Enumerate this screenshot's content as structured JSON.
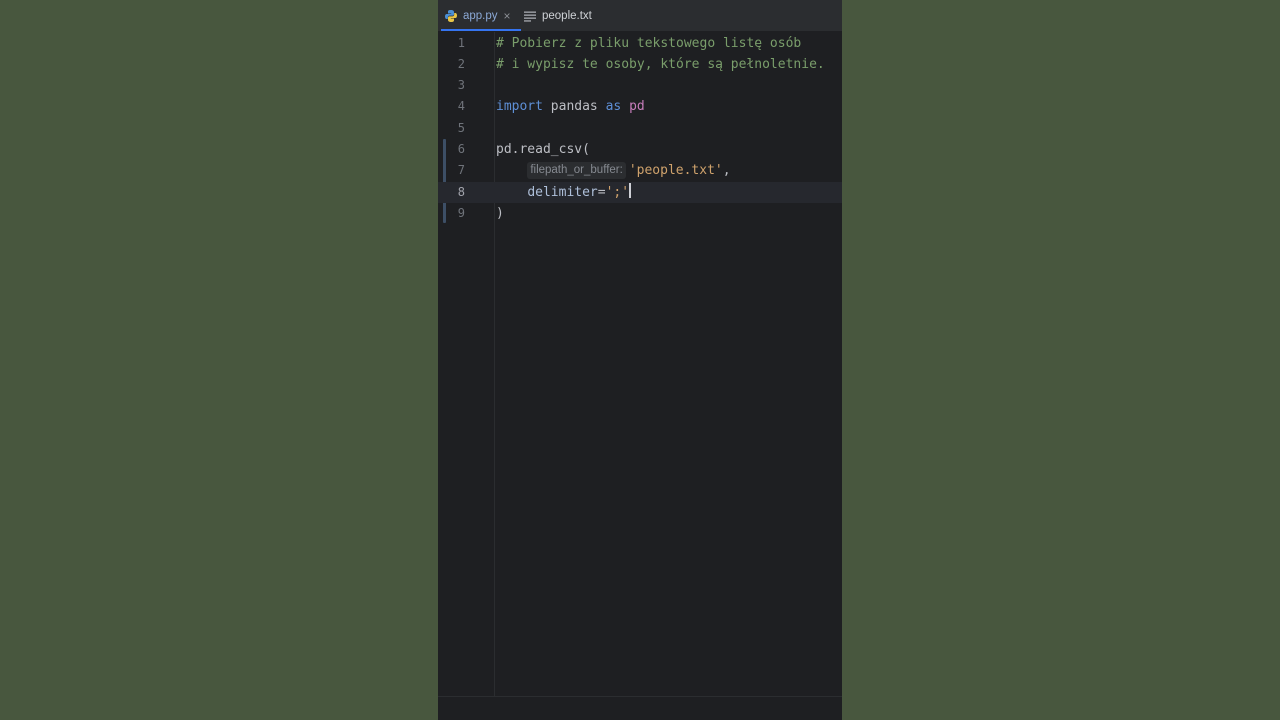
{
  "tabs": [
    {
      "label": "app.py",
      "icon": "python-icon",
      "active": true,
      "close": "×"
    },
    {
      "label": "people.txt",
      "icon": "text-file-icon",
      "active": false
    }
  ],
  "editor": {
    "current_line": 8,
    "lines": [
      {
        "n": "1",
        "tokens": [
          {
            "t": "# Pobierz z pliku tekstowego listę osób",
            "c": "comment"
          }
        ]
      },
      {
        "n": "2",
        "tokens": [
          {
            "t": "# i wypisz te osoby, które są pełnoletnie.",
            "c": "comment"
          }
        ]
      },
      {
        "n": "3",
        "tokens": []
      },
      {
        "n": "4",
        "tokens": [
          {
            "t": "import",
            "c": "kw"
          },
          {
            "t": " pandas ",
            "c": ""
          },
          {
            "t": "as",
            "c": "kw"
          },
          {
            "t": " ",
            "c": ""
          },
          {
            "t": "pd",
            "c": "alias"
          }
        ]
      },
      {
        "n": "5",
        "tokens": []
      },
      {
        "n": "6",
        "tokens": [
          {
            "t": "pd.read_csv(",
            "c": ""
          }
        ]
      },
      {
        "n": "7",
        "tokens": [
          {
            "t": "    ",
            "c": ""
          },
          {
            "t": "filepath_or_buffer:",
            "c": "hint"
          },
          {
            "t": "'people.txt'",
            "c": "str2"
          },
          {
            "t": ",",
            "c": ""
          }
        ]
      },
      {
        "n": "8",
        "tokens": [
          {
            "t": "    ",
            "c": ""
          },
          {
            "t": "delimiter",
            "c": "param"
          },
          {
            "t": "=",
            "c": ""
          },
          {
            "t": "';'",
            "c": "str2"
          }
        ]
      },
      {
        "n": "9",
        "tokens": [
          {
            "t": ")",
            "c": ""
          }
        ]
      }
    ]
  },
  "colors": {
    "background": "#48573e",
    "editor_bg": "#1e1f22",
    "comment": "#7a9e6b",
    "keyword": "#5e8fd6",
    "string": "#cfa26c",
    "tab_active": "#8ca9d6"
  }
}
